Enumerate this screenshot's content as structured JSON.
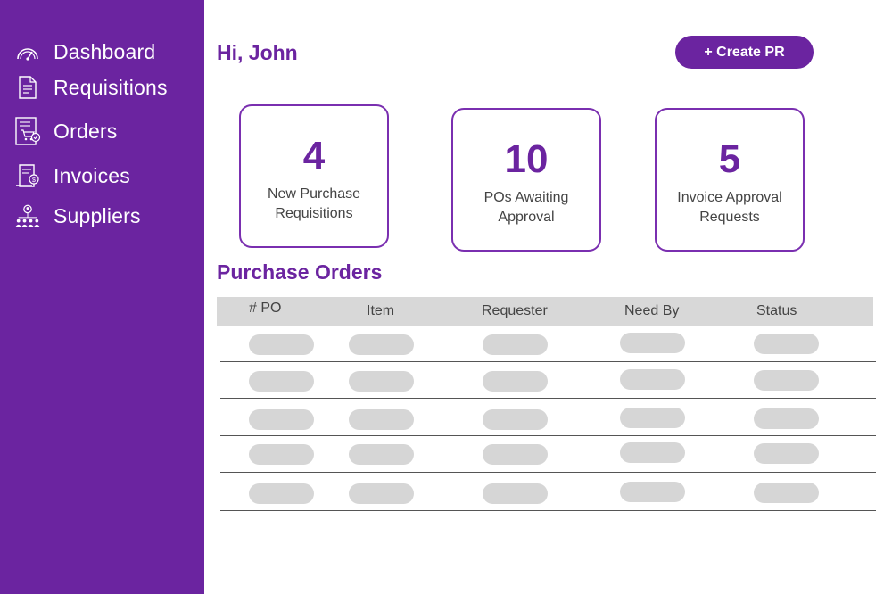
{
  "sidebar": {
    "items": [
      {
        "label": "Dashboard",
        "icon": "gauge-icon"
      },
      {
        "label": "Requisitions",
        "icon": "document-icon"
      },
      {
        "label": "Orders",
        "icon": "cart-document-icon"
      },
      {
        "label": "Invoices",
        "icon": "invoice-icon"
      },
      {
        "label": "Suppliers",
        "icon": "network-people-icon"
      }
    ]
  },
  "header": {
    "greeting": "Hi, John",
    "create_label": "+ Create PR"
  },
  "stats": [
    {
      "count": "4",
      "line1": "New Purchase",
      "line2": "Requisitions"
    },
    {
      "count": "10",
      "line1": "POs Awaiting",
      "line2": "Approval"
    },
    {
      "count": "5",
      "line1": "Invoice Approval",
      "line2": "Requests"
    }
  ],
  "orders": {
    "title": "Purchase Orders",
    "columns": [
      "# PO",
      "Item",
      "Requester",
      "Need By",
      "Status"
    ],
    "row_count": 5
  },
  "colors": {
    "brand": "#6b24a0",
    "placeholder": "#d6d6d6",
    "header_bg": "#d8d8d8"
  }
}
